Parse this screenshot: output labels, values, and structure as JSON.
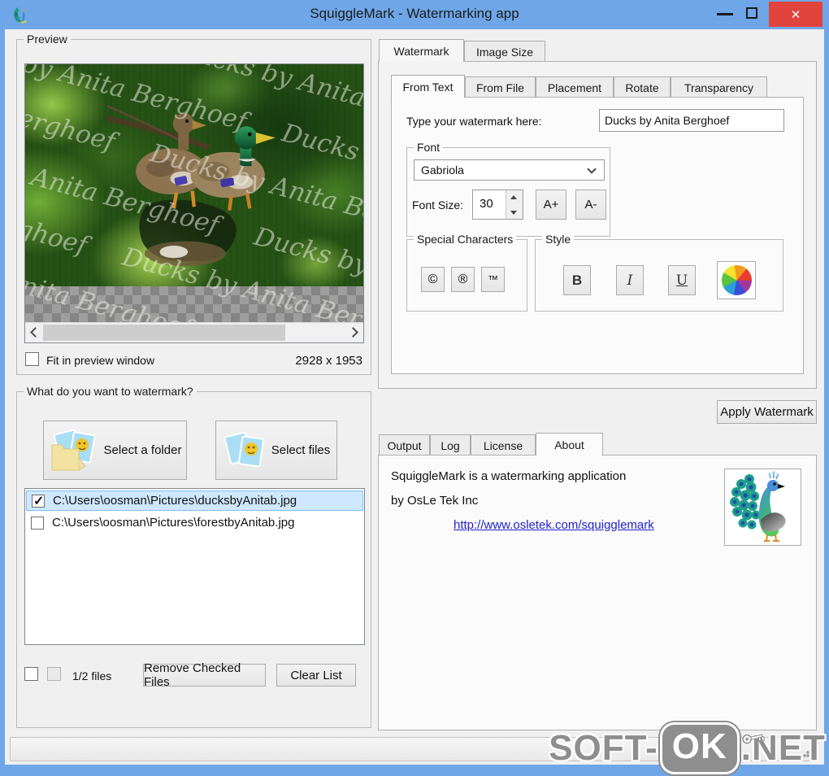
{
  "window": {
    "title": "SquiggleMark - Watermarking app",
    "close_glyph": "✕"
  },
  "preview": {
    "group_label": "Preview",
    "watermark_text": "Ducks by Anita Berghoef",
    "fit_checkbox_label": "Fit in preview window",
    "dimensions": "2928 x 1953"
  },
  "files": {
    "group_label": "What do you want to watermark?",
    "select_folder_label": "Select a folder",
    "select_files_label": "Select files",
    "items": [
      {
        "path": "C:\\Users\\oosman\\Pictures\\ducksbyAnitab.jpg",
        "checked": true,
        "selected": true
      },
      {
        "path": "C:\\Users\\oosman\\Pictures\\forestbyAnitab.jpg",
        "checked": false,
        "selected": false
      }
    ],
    "count_label": "1/2 files",
    "remove_button_label": "Remove Checked Files",
    "clear_button_label": "Clear List"
  },
  "watermark_panel": {
    "tabs": [
      "Watermark",
      "Image Size"
    ],
    "active_tab": "Watermark",
    "inner_tabs": [
      "From Text",
      "From File",
      "Placement",
      "Rotate",
      "Transparency"
    ],
    "active_inner_tab": "From Text",
    "type_label": "Type your watermark here:",
    "watermark_value": "Ducks by Anita Berghoef",
    "font": {
      "group_label": "Font",
      "family_value": "Gabriola",
      "size_label": "Font Size:",
      "size_value": "30",
      "increase_label": "A+",
      "decrease_label": "A-"
    },
    "special_characters": {
      "group_label": "Special Characters",
      "copyright": "©",
      "registered": "®",
      "trademark": "™"
    },
    "style": {
      "group_label": "Style",
      "bold": "B",
      "italic": "I",
      "underline": "U"
    }
  },
  "apply_button_label": "Apply Watermark",
  "info_panel": {
    "tabs": [
      "Output",
      "Log",
      "License",
      "About"
    ],
    "active_tab": "About",
    "about_line1": "SquiggleMark is a watermarking application",
    "about_line2": "by OsLe Tek Inc",
    "link": "http://www.osletek.com/squigglemark"
  },
  "brand_overlay": {
    "pre": "SOFT-",
    "mid": "OK",
    "post": ".NET"
  },
  "glyphs": {
    "checkmark": "✓"
  },
  "colors": {
    "titlebar": "#6ea6e7",
    "close_red": "#e0443c",
    "selection_fill": "#cfe8ff",
    "selection_border": "#7fc0f5",
    "link_blue": "#2121cc"
  }
}
